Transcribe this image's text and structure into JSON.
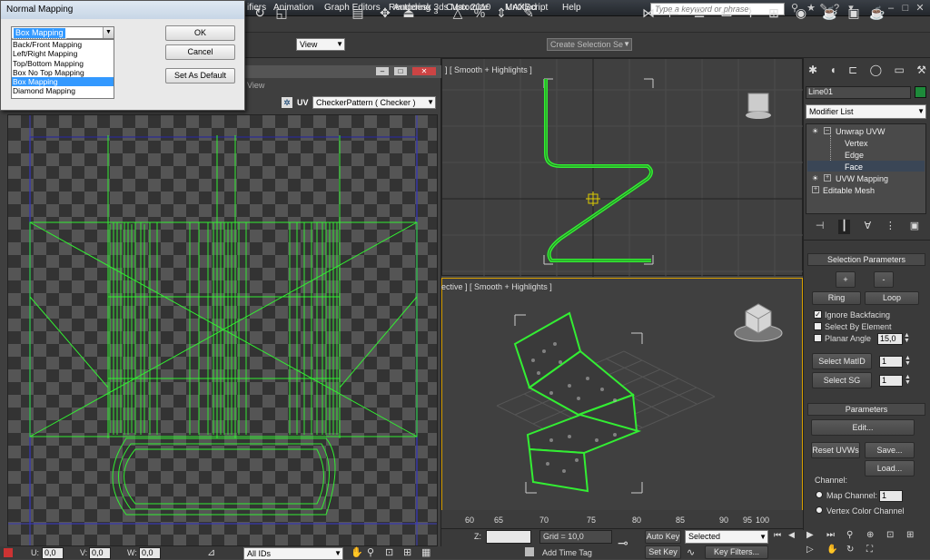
{
  "titlebar": {
    "app": "Autodesk 3ds Max  2010",
    "doc": "Untitled",
    "search_placeholder": "Type a keyword or phrase"
  },
  "menu": [
    "ifiers",
    "Animation",
    "Graph Editors",
    "Rendering",
    "Customize",
    "MAXScript",
    "Help"
  ],
  "toolbar": {
    "view_combo": "View",
    "selection_set_placeholder": "Create Selection Se"
  },
  "uv_editor": {
    "menu_tail": "View",
    "texture_combo": "CheckerPattern  ( Checker )",
    "uv_label": "UV",
    "status": {
      "u_label": "U:",
      "u_value": "0,0",
      "v_label": "V:",
      "v_value": "0,0",
      "w_label": "W:",
      "w_value": "0,0",
      "ids_combo": "All IDs"
    }
  },
  "viewport_top": {
    "label": "] [ Smooth + Highlights ]"
  },
  "viewport_persp": {
    "label": "ective ] [ Smooth + Highlights ]"
  },
  "command_panel": {
    "object_name": "Line01",
    "modifier_list": "Modifier List",
    "stack": [
      {
        "label": "Unwrap UVW",
        "level": 0,
        "selected": false
      },
      {
        "label": "Vertex",
        "level": 1,
        "selected": false
      },
      {
        "label": "Edge",
        "level": 1,
        "selected": false
      },
      {
        "label": "Face",
        "level": 1,
        "selected": true
      },
      {
        "label": "UVW Mapping",
        "level": 0,
        "selected": false
      },
      {
        "label": "Editable Mesh",
        "level": 0,
        "selected": false
      }
    ],
    "selection_params": {
      "title": "Selection Parameters",
      "plus": "+",
      "minus": "-",
      "ring": "Ring",
      "loop": "Loop",
      "ignore_backfacing": "Ignore Backfacing",
      "select_by_element": "Select By Element",
      "planar_angle": "Planar Angle",
      "planar_angle_value": "15,0",
      "select_matid": "Select MatID",
      "matid_value": "1",
      "select_sg": "Select SG",
      "sg_value": "1"
    },
    "parameters": {
      "title": "Parameters",
      "edit": "Edit...",
      "reset_uvws": "Reset UVWs",
      "save": "Save...",
      "load": "Load...",
      "channel_label": "Channel:",
      "map_channel": "Map Channel:",
      "map_channel_value": "1",
      "vertex_color_channel": "Vertex Color Channel"
    }
  },
  "bottom": {
    "ruler": [
      "60",
      "65",
      "70",
      "75",
      "80",
      "85",
      "90",
      "95",
      "100"
    ],
    "z_label": "Z:",
    "grid": "Grid = 10,0",
    "add_time_tag": "Add Time Tag",
    "auto_key": "Auto Key",
    "set_key": "Set Key",
    "selected": "Selected",
    "key_filters": "Key Filters..."
  },
  "dialog": {
    "title": "Normal Mapping",
    "combo_value": "Box Mapping",
    "options": [
      "Back/Front Mapping",
      "Left/Right Mapping",
      "Top/Bottom Mapping",
      "Box No Top Mapping",
      "Box Mapping",
      "Diamond Mapping"
    ],
    "selected_index": 4,
    "ok": "OK",
    "cancel": "Cancel",
    "set_default": "Set As Default"
  },
  "colors": {
    "wire": "#33ee33",
    "selection_blue": "#3399ff",
    "panel": "#3a3a3a"
  }
}
